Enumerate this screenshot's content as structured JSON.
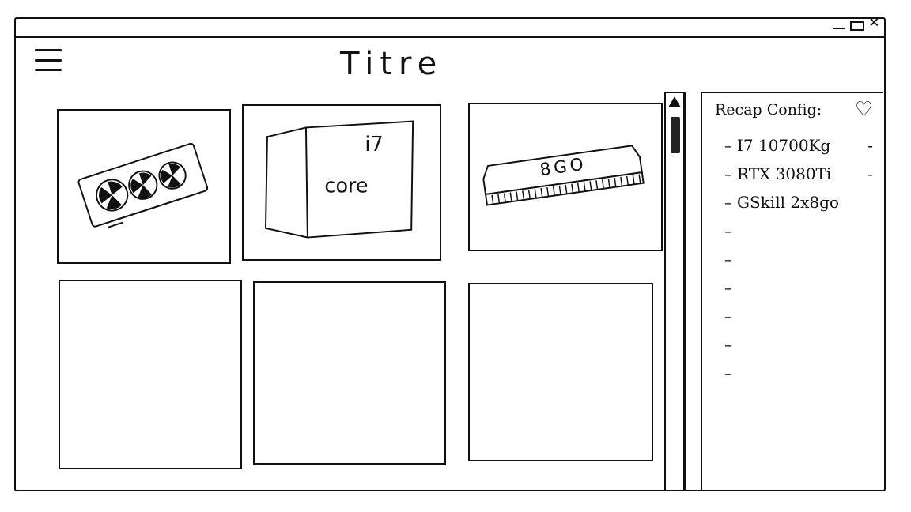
{
  "window": {
    "controls": {
      "minimize": "–",
      "close": "×"
    }
  },
  "header": {
    "title": "Titre"
  },
  "products": [
    {
      "name": "gpu-card",
      "label": ""
    },
    {
      "name": "cpu-box",
      "label": "i7",
      "sub": "core"
    },
    {
      "name": "ram-stick",
      "label": "8GO"
    },
    {
      "name": "empty-tile",
      "label": ""
    },
    {
      "name": "empty-tile",
      "label": ""
    },
    {
      "name": "empty-tile",
      "label": ""
    }
  ],
  "recap": {
    "title": "Recap Config:",
    "items": [
      {
        "text": "I7 10700Kg",
        "remove": "-"
      },
      {
        "text": "RTX 3080Ti",
        "remove": "-"
      },
      {
        "text": "GSkill 2x8go",
        "remove": ""
      },
      {
        "text": "",
        "remove": ""
      },
      {
        "text": "",
        "remove": ""
      },
      {
        "text": "",
        "remove": ""
      },
      {
        "text": "",
        "remove": ""
      },
      {
        "text": "",
        "remove": ""
      },
      {
        "text": "",
        "remove": ""
      }
    ]
  },
  "colors": {
    "ink": "#111111",
    "background": "#ffffff"
  }
}
